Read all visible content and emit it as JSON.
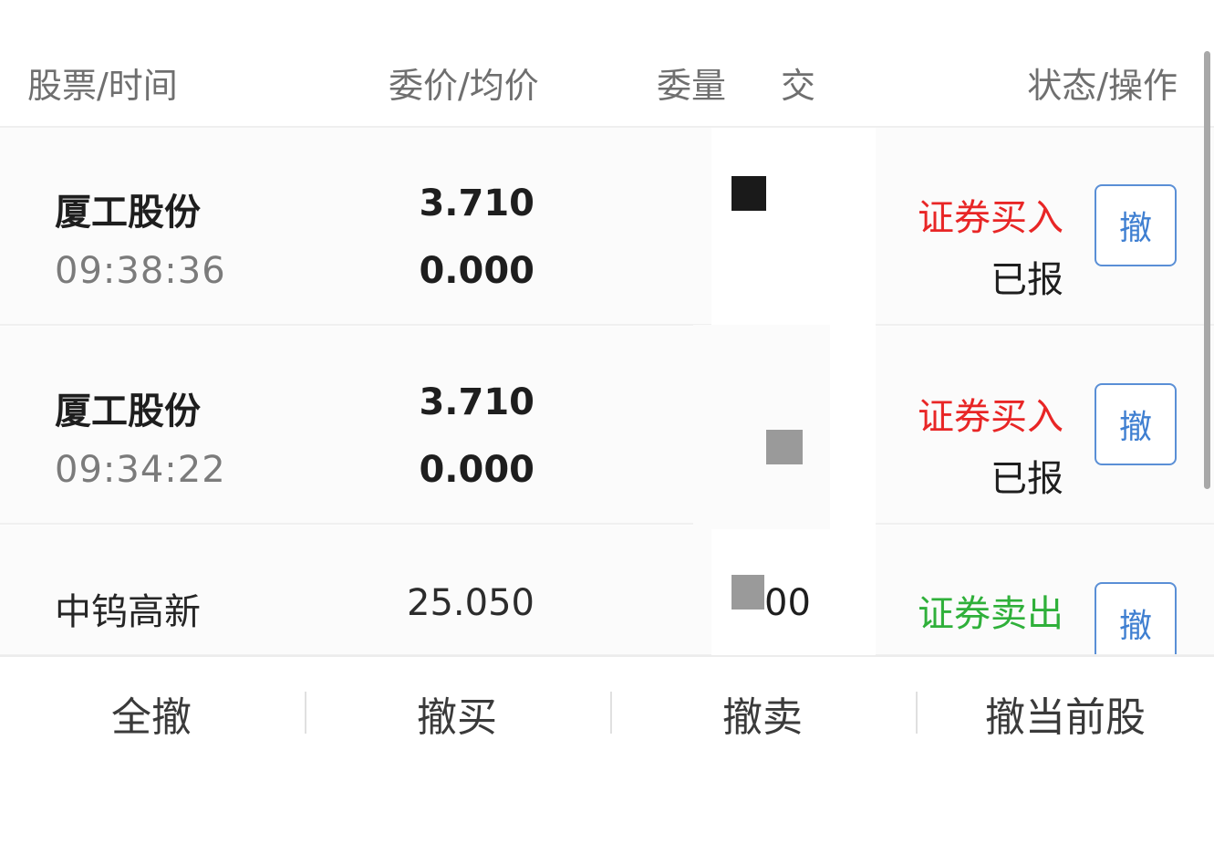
{
  "header": {
    "col_stock": "股票/时间",
    "col_price": "委价/均价",
    "col_qty": "委量",
    "col_qty_suffix": "交",
    "col_status": "状态/操作"
  },
  "orders": [
    {
      "name": "厦工股份",
      "time": "09:38:36",
      "price": "3.710",
      "avg_price": "0.000",
      "qty": "",
      "type": "证券买入",
      "status": "已报",
      "cancel_label": "撤"
    },
    {
      "name": "厦工股份",
      "time": "09:34:22",
      "price": "3.710",
      "avg_price": "0.000",
      "qty": "",
      "type": "证券买入",
      "status": "已报",
      "cancel_label": "撤"
    },
    {
      "name": "中钨高新",
      "time": "",
      "price": "25.050",
      "avg_price": "",
      "qty": "00",
      "type": "证券卖出",
      "status": "",
      "cancel_label": "撤"
    }
  ],
  "actions": {
    "cancel_all": "全撤",
    "cancel_buy": "撤买",
    "cancel_sell": "撤卖",
    "cancel_current": "撤当前股"
  },
  "colors": {
    "buy": "#e82626",
    "sell": "#2fb03a",
    "cancel_button": "#3f7fd1"
  }
}
